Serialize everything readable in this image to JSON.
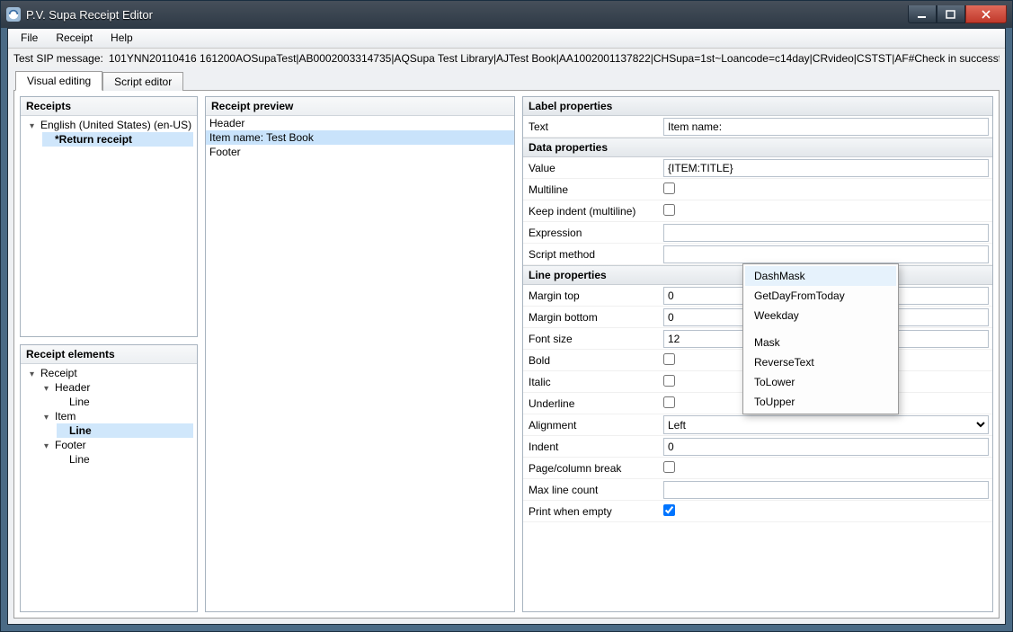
{
  "window": {
    "title": "P.V. Supa Receipt Editor"
  },
  "menubar": {
    "file": "File",
    "receipt": "Receipt",
    "help": "Help"
  },
  "sip": {
    "label": "Test SIP message:",
    "value": "101YNN20110416   161200AOSupaTest|AB0002003314735|AQSupa Test Library|AJTest Book|AA1002001137822|CHSupa=1st~Loancode=c14day|CRvideo|CSTST|AF#Check in successful."
  },
  "tabs": {
    "visual": "Visual editing",
    "script": "Script editor"
  },
  "receipts_panel": {
    "title": "Receipts",
    "root": "English (United States) (en-US)",
    "item": "*Return receipt"
  },
  "elements_panel": {
    "title": "Receipt elements",
    "root": "Receipt",
    "header": "Header",
    "item": "Item",
    "footer": "Footer",
    "line": "Line"
  },
  "preview": {
    "title": "Receipt preview",
    "lines": {
      "header": "Header",
      "item": "Item name: Test Book",
      "footer": "Footer"
    }
  },
  "props": {
    "label_section": "Label properties",
    "text_label": "Text",
    "text_value": "Item name:",
    "data_section": "Data properties",
    "value_label": "Value",
    "value_value": "{ITEM:TITLE}",
    "multiline_label": "Multiline",
    "keepindent_label": "Keep indent (multiline)",
    "expression_label": "Expression",
    "scriptmethod_label": "Script method",
    "line_section": "Line properties",
    "margin_top_label": "Margin top",
    "margin_top_value": "0",
    "margin_bottom_label": "Margin bottom",
    "margin_bottom_value": "0",
    "font_size_label": "Font size",
    "font_size_value": "12",
    "bold_label": "Bold",
    "italic_label": "Italic",
    "underline_label": "Underline",
    "alignment_label": "Alignment",
    "alignment_value": "Left",
    "indent_label": "Indent",
    "indent_value": "0",
    "pagebreak_label": "Page/column break",
    "maxline_label": "Max line count",
    "printempty_label": "Print when empty"
  },
  "dropdown": {
    "dashmask": "DashMask",
    "getday": "GetDayFromToday",
    "weekday": "Weekday",
    "mask": "Mask",
    "reverse": "ReverseText",
    "tolower": "ToLower",
    "toupper": "ToUpper"
  }
}
